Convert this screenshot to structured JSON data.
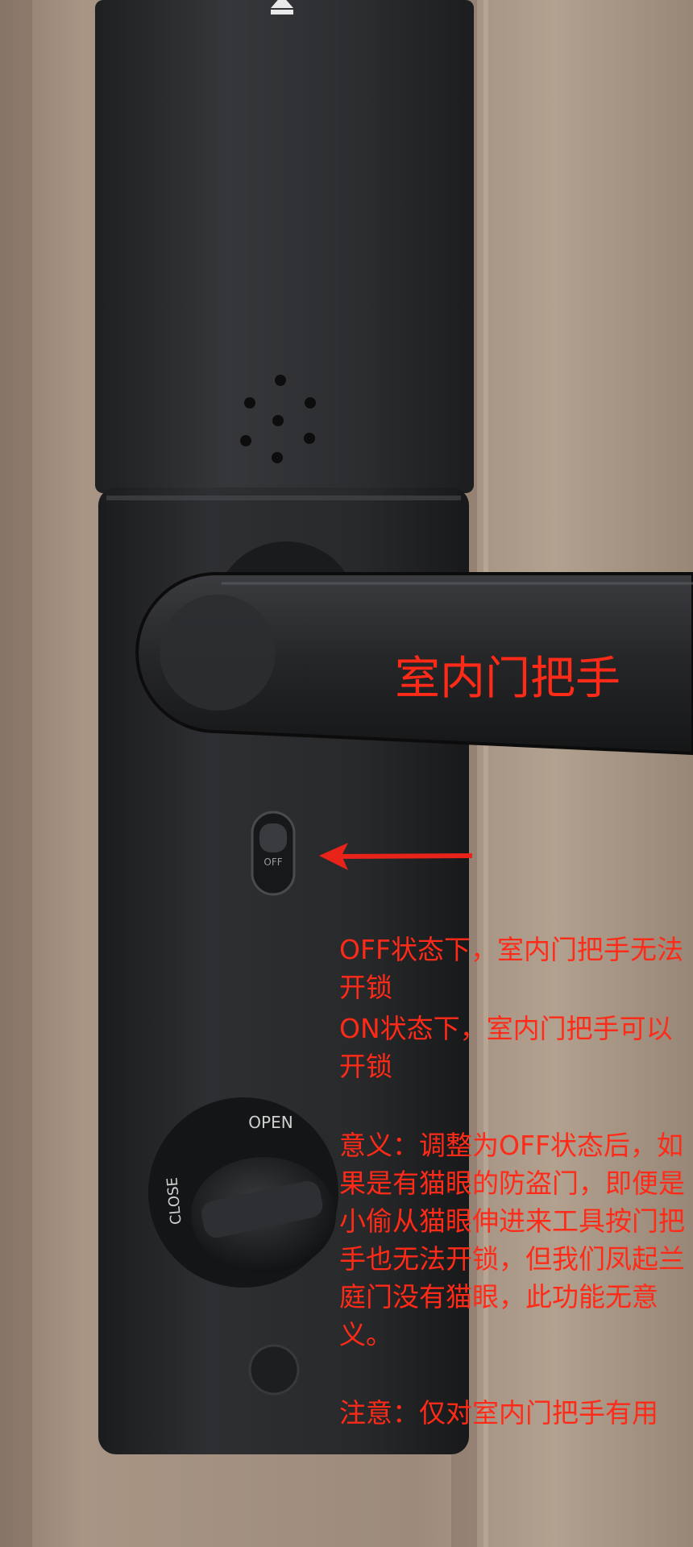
{
  "annotations": {
    "handle_label": "室内门把手",
    "off_state": "OFF状态下，室内门把手无法开锁",
    "on_state": "ON状态下，室内门把手可以开锁",
    "meaning": "意义：调整为OFF状态后，如果是有猫眼的防盗门，即便是小偷从猫眼伸进来工具按门把手也无法开锁，但我们凤起兰庭门没有猫眼，此功能无意义。",
    "attention": "注意：仅对室内门把手有用"
  },
  "device_markings": {
    "switch": "OFF",
    "knob_top": "OPEN",
    "knob_left": "CLOSE"
  },
  "colors": {
    "annotation": "#ff2a17",
    "lock_body": "#2f3033",
    "door_wood": "#a08e7f"
  }
}
